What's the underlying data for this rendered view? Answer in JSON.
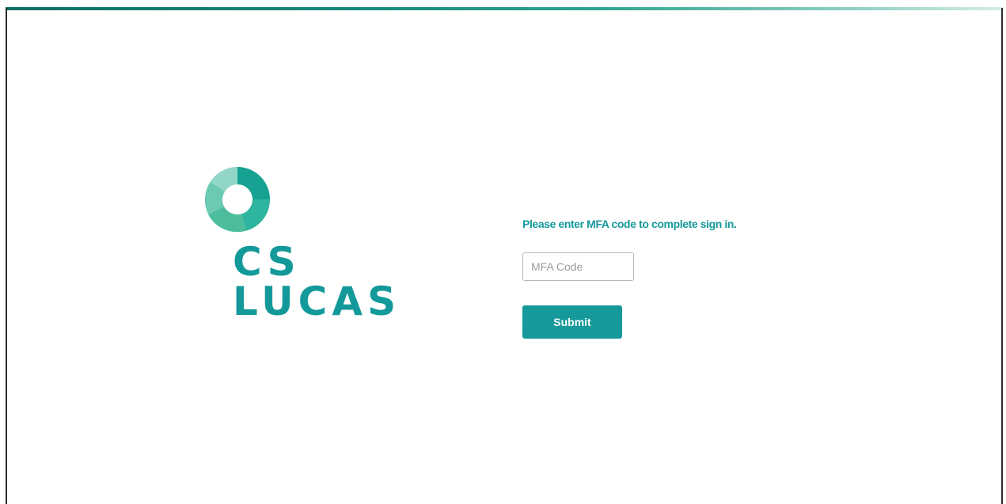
{
  "branding": {
    "logo_line1": "CS",
    "logo_line2": "LUCAS",
    "brand_color": "#15999a",
    "logo_icon": "donut-ring-icon"
  },
  "mfa_form": {
    "prompt": "Please enter MFA code to complete sign in.",
    "input_placeholder": "MFA Code",
    "input_value": "",
    "submit_label": "Submit"
  },
  "colors": {
    "accent": "#15999a",
    "top_bar_start": "#0f6f63",
    "top_bar_end": "#d3ede7"
  }
}
